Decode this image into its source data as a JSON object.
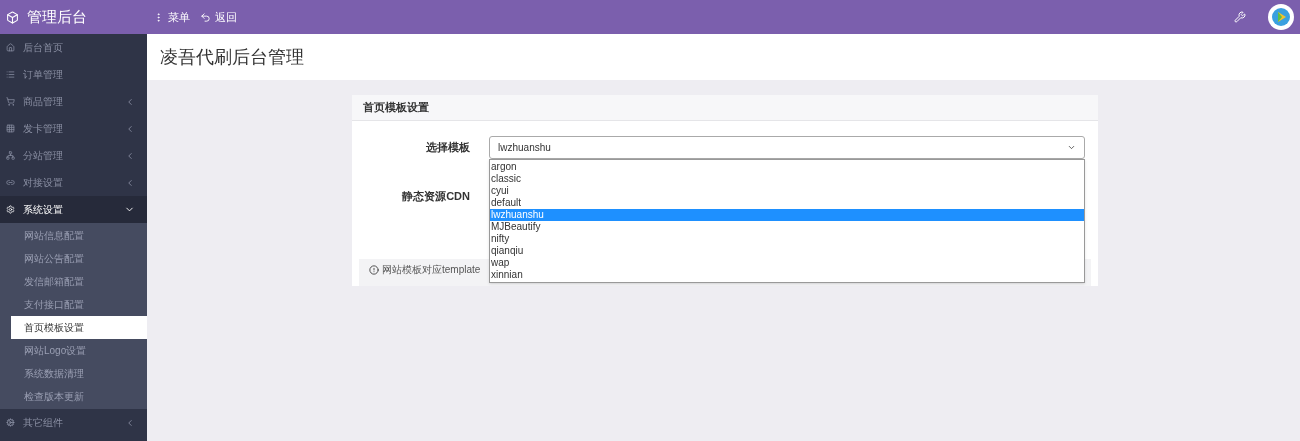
{
  "header": {
    "brand": "管理后台",
    "menu_label": "菜单",
    "back_label": "返回"
  },
  "sidebar": {
    "items": [
      {
        "label": "后台首页",
        "has_children": false,
        "expanded": false
      },
      {
        "label": "订单管理",
        "has_children": false,
        "expanded": false
      },
      {
        "label": "商品管理",
        "has_children": true,
        "expanded": false
      },
      {
        "label": "发卡管理",
        "has_children": true,
        "expanded": false
      },
      {
        "label": "分站管理",
        "has_children": true,
        "expanded": false
      },
      {
        "label": "对接设置",
        "has_children": true,
        "expanded": false
      },
      {
        "label": "系统设置",
        "has_children": true,
        "expanded": true,
        "children": [
          {
            "label": "网站信息配置",
            "selected": false
          },
          {
            "label": "网站公告配置",
            "selected": false
          },
          {
            "label": "发信邮箱配置",
            "selected": false
          },
          {
            "label": "支付接口配置",
            "selected": false
          },
          {
            "label": "首页模板设置",
            "selected": true
          },
          {
            "label": "网站Logo设置",
            "selected": false
          },
          {
            "label": "系统数据清理",
            "selected": false
          },
          {
            "label": "检查版本更新",
            "selected": false
          }
        ]
      },
      {
        "label": "其它组件",
        "has_children": true,
        "expanded": false
      }
    ]
  },
  "page_title": "凌吾代刷后台管理",
  "card": {
    "title": "首页模板设置",
    "template_field": {
      "label": "选择模板",
      "value": "lwzhuanshu",
      "options": [
        {
          "label": "argon",
          "selected": false
        },
        {
          "label": "classic",
          "selected": false
        },
        {
          "label": "cyui",
          "selected": false
        },
        {
          "label": "default",
          "selected": false
        },
        {
          "label": "lwzhuanshu",
          "selected": true
        },
        {
          "label": "MJBeautify",
          "selected": false
        },
        {
          "label": "nifty",
          "selected": false
        },
        {
          "label": "qianqiu",
          "selected": false
        },
        {
          "label": "wap",
          "selected": false
        },
        {
          "label": "xinnian",
          "selected": false
        }
      ]
    },
    "cdn_label": "静态资源CDN",
    "hint": "网站模板对应template"
  }
}
